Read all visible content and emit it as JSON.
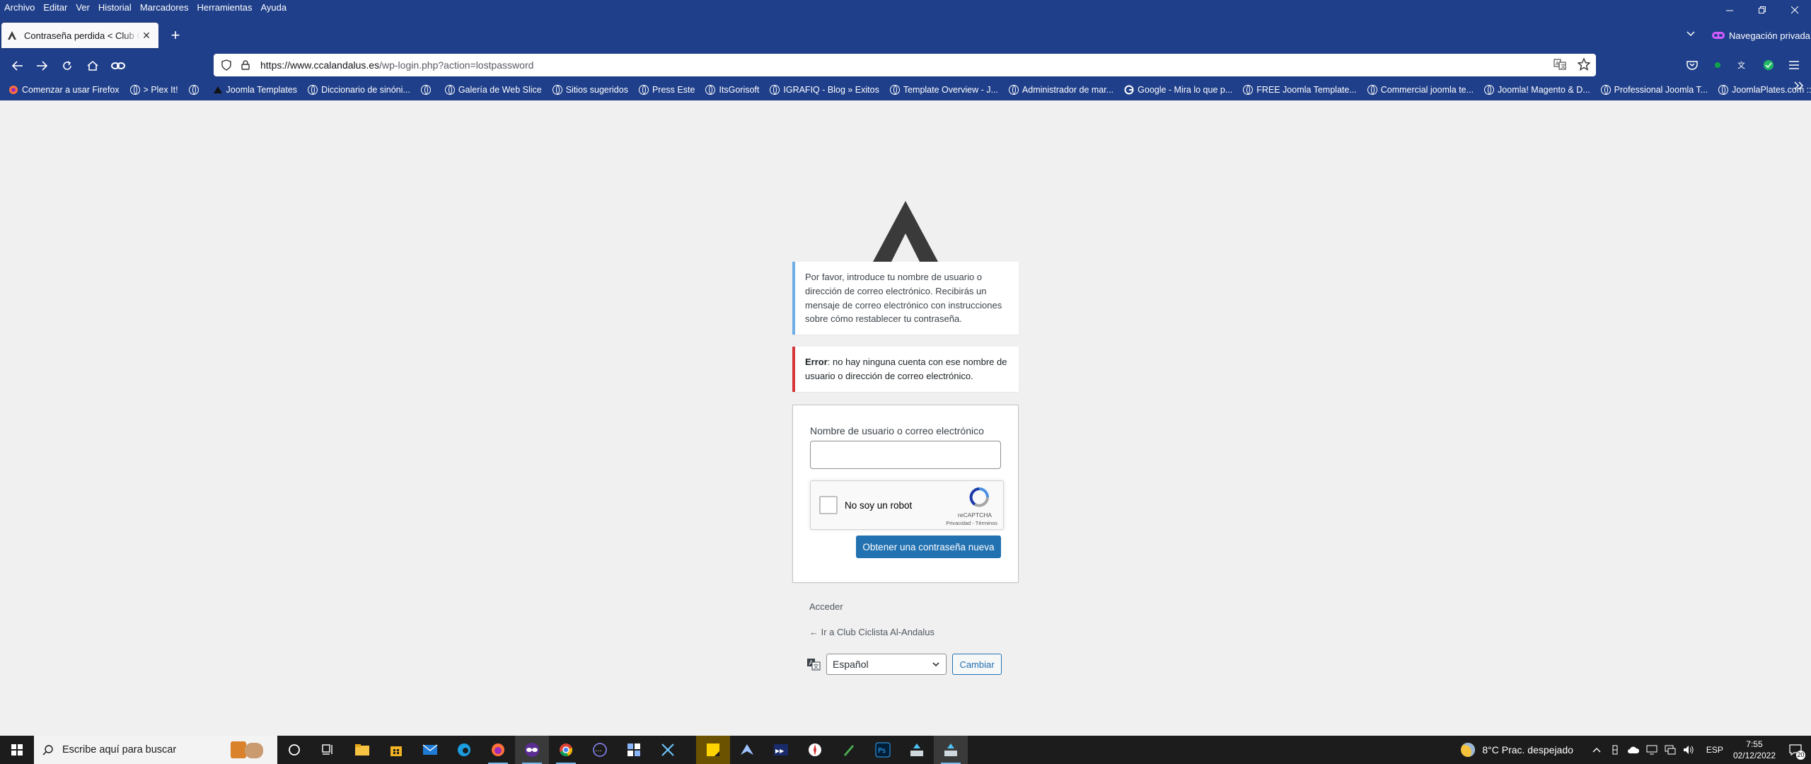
{
  "browser": {
    "menu": [
      "Archivo",
      "Editar",
      "Ver",
      "Historial",
      "Marcadores",
      "Herramientas",
      "Ayuda"
    ],
    "tab_title": "Contraseña perdida < Club Ciclista Al-Andalus",
    "private_label": "Navegación privada",
    "url_host": "https://www.ccalandalus.es",
    "url_path": "/wp-login.php?action=lostpassword",
    "bookmarks": [
      "Comenzar a usar Firefox",
      "> Plex It!",
      "",
      "Joomla Templates",
      "Diccionario de sinóni...",
      "",
      "Galería de Web Slice",
      "Sitios sugeridos",
      "Press Este",
      "ItsGorisoft",
      "IGRAFIQ - Blog » Exitos",
      "Template Overview - J...",
      "Administrador de mar...",
      "Google - Mira lo que p...",
      "FREE Joomla Template...",
      "Commercial joomla te...",
      "Joomla! Magento & D...",
      "Professional Joomla T...",
      "JoomlaPlates.com :: D..."
    ]
  },
  "page": {
    "info_message": "Por favor, introduce tu nombre de usuario o dirección de correo electrónico. Recibirás un mensaje de correo electrónico con instrucciones sobre cómo restablecer tu contraseña.",
    "error_label": "Error",
    "error_text": ": no hay ninguna cuenta con ese nombre de usuario o dirección de correo electrónico.",
    "user_label": "Nombre de usuario o correo electrónico",
    "user_value": "",
    "recaptcha_label": "No soy un robot",
    "recaptcha_brand": "reCAPTCHA",
    "recaptcha_links": "Privacidad - Términos",
    "submit_label": "Obtener una contraseña nueva",
    "login_link": "Acceder",
    "back_link": "← Ir a Club Ciclista Al-Andalus",
    "language_selected": "Español",
    "change_button": "Cambiar"
  },
  "taskbar": {
    "search_placeholder": "Escribe aquí para buscar",
    "weather": "8°C  Prac. despejado",
    "lang": "ESP",
    "time": "7:55",
    "date": "02/12/2022",
    "notifications": "20"
  },
  "colors": {
    "chrome": "#1f3f8a",
    "wp_blue": "#2271b1",
    "error_red": "#d63638",
    "info_blue": "#72aee6"
  }
}
